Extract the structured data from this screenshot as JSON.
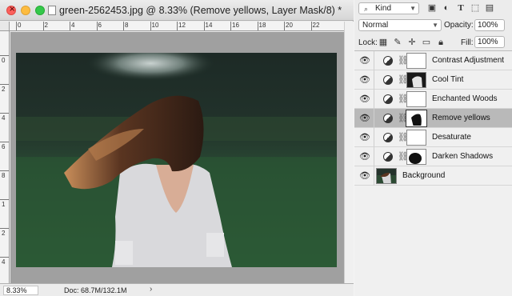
{
  "document": {
    "title": "green-2562453.jpg @ 8.33% (Remove yellows, Layer Mask/8) *",
    "zoom": "8.33%",
    "doc_size": "Doc: 68.7M/132.1M",
    "ruler_top_labels": [
      "0",
      "2",
      "4",
      "6",
      "8",
      "10",
      "12",
      "14",
      "16",
      "18",
      "20",
      "22"
    ],
    "ruler_left_labels": [
      "0",
      "2",
      "4",
      "6",
      "8",
      "1",
      "2",
      "4"
    ]
  },
  "panel": {
    "kind_label": "Kind",
    "blend_mode": "Normal",
    "opacity_label": "Opacity:",
    "opacity_value": "100%",
    "lock_label": "Lock:",
    "fill_label": "Fill:",
    "fill_value": "100%",
    "filter_icons": [
      "image-filter-icon",
      "adjustment-filter-icon",
      "type-filter-icon",
      "shape-filter-icon",
      "smart-object-filter-icon"
    ],
    "lock_icons": [
      "lock-transparent-icon",
      "lock-image-icon",
      "lock-position-icon",
      "lock-artboard-icon",
      "lock-all-icon"
    ]
  },
  "layers": [
    {
      "name": "Contrast Adjustment",
      "selected": false,
      "mask": "white"
    },
    {
      "name": "Cool Tint",
      "selected": false,
      "mask": "photo"
    },
    {
      "name": "Enchanted Woods",
      "selected": false,
      "mask": "white"
    },
    {
      "name": "Remove yellows",
      "selected": true,
      "mask": "silhouette"
    },
    {
      "name": "Desaturate",
      "selected": false,
      "mask": "white"
    },
    {
      "name": "Darken Shadows",
      "selected": false,
      "mask": "blob"
    },
    {
      "name": "Background",
      "selected": false,
      "mask": "background"
    }
  ],
  "colors": {
    "selected_layer": "#b9b9b9",
    "close": "#fc605c",
    "minimize": "#fdbc40",
    "maximize": "#34c84a"
  }
}
